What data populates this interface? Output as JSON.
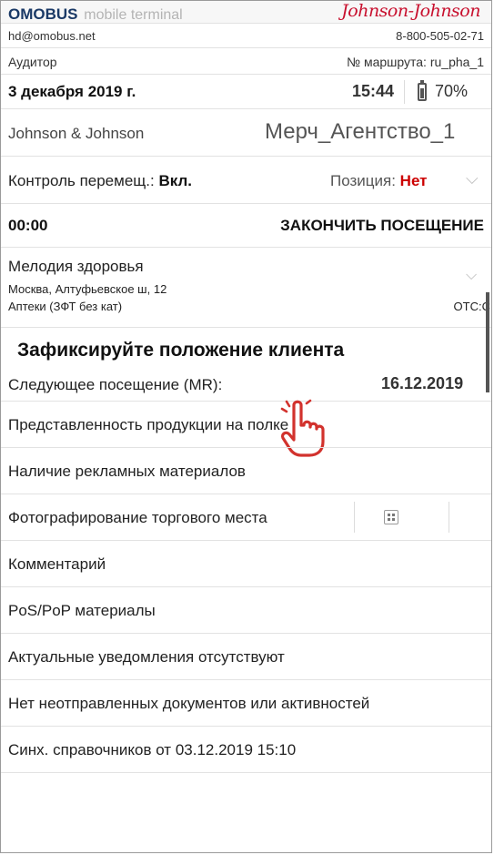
{
  "header": {
    "brand_name": "OMOBUS",
    "brand_sub": "mobile terminal",
    "logo_text": "Johnson-Johnson",
    "email": "hd@omobus.net",
    "phone": "8-800-505-02-71",
    "role": "Аудитор",
    "route": "№ маршрута: ru_pha_1",
    "date": "3 декабря 2019 г.",
    "time": "15:44",
    "battery": "70%",
    "battery_level": 0.7,
    "company": "Johnson & Johnson",
    "agency": "Мерч_Агентство_1"
  },
  "controls": {
    "movement_label": "Контроль перемещ.:",
    "movement_value": "Вкл.",
    "position_label": "Позиция:",
    "position_value": "Нет",
    "chevron": "⌵"
  },
  "visit": {
    "timer": "00:00",
    "end_button": "ЗАКОНЧИТЬ ПОСЕЩЕНИЕ"
  },
  "client": {
    "name": "Мелодия здоровья",
    "address": "Москва, Алтуфьевское ш, 12",
    "channel": "Аптеки (ЗФТ без кат)",
    "code": "ОТС:С",
    "chevron": "⌵"
  },
  "fix_position": "Зафиксируйте положение клиента",
  "next_visit": {
    "label": "Следующее посещение (MR):",
    "date": "16.12.2019"
  },
  "menu": [
    "Представленность продукции на полке",
    "Наличие рекламных материалов",
    "Фотографирование торгового места",
    "Комментарий",
    "PoS/PoP материалы",
    "Актуальные уведомления отсутствуют",
    "Нет неотправленных документов или активностей",
    "Синх. справочников от 03.12.2019 15:10"
  ],
  "icons": {
    "battery": "battery-icon",
    "grid": "grid-icon",
    "hand": "hand-pointer-icon"
  },
  "colors": {
    "brand": "#1a3966",
    "logo": "#c8102e",
    "accent_red": "#cc0000"
  }
}
